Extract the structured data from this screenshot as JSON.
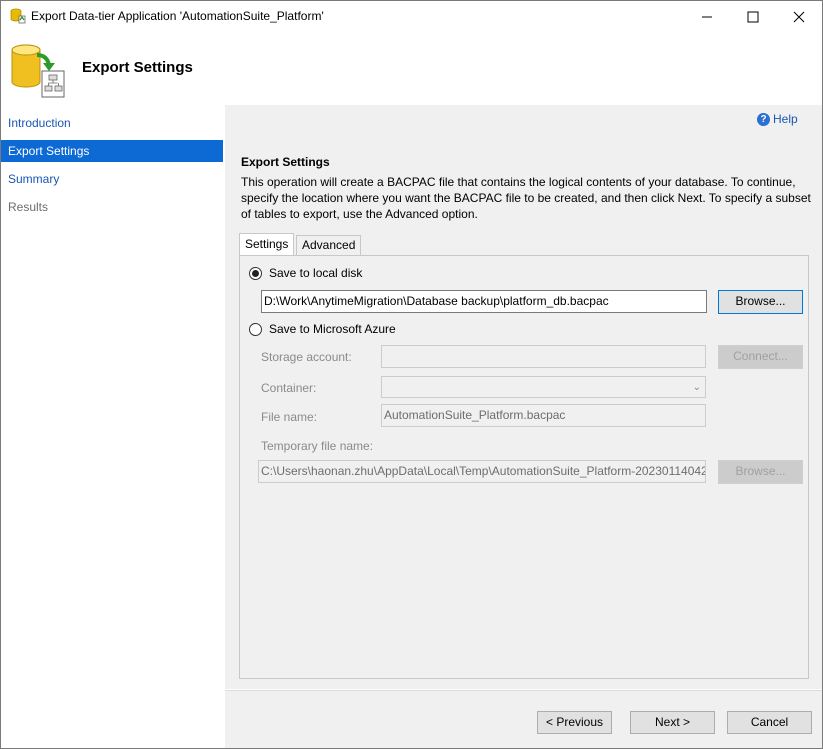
{
  "window": {
    "title": "Export Data-tier Application 'AutomationSuite_Platform'"
  },
  "header": {
    "title": "Export Settings"
  },
  "nav": {
    "items": [
      {
        "label": "Introduction"
      },
      {
        "label": "Export Settings"
      },
      {
        "label": "Summary"
      },
      {
        "label": "Results"
      }
    ]
  },
  "main": {
    "help_label": "Help",
    "section_title": "Export Settings",
    "description": "This operation will create a BACPAC file that contains the logical contents of your database. To continue, specify the location where you want the BACPAC file to be created, and then click Next. To specify a subset of tables to export, use the Advanced option.",
    "tabs": [
      {
        "label": "Settings"
      },
      {
        "label": "Advanced"
      }
    ],
    "local": {
      "radio_label": "Save to local disk",
      "path_value": "D:\\Work\\AnytimeMigration\\Database backup\\platform_db.bacpac",
      "browse_label": "Browse..."
    },
    "azure": {
      "radio_label": "Save to Microsoft Azure",
      "storage_label": "Storage account:",
      "storage_value": "",
      "connect_label": "Connect...",
      "container_label": "Container:",
      "container_value": "",
      "filename_label": "File name:",
      "filename_value": "AutomationSuite_Platform.bacpac",
      "temp_label": "Temporary file name:",
      "temp_value": "C:\\Users\\haonan.zhu\\AppData\\Local\\Temp\\AutomationSuite_Platform-20230114042",
      "browse_label": "Browse..."
    }
  },
  "footer": {
    "previous_label": "< Previous",
    "next_label": "Next >",
    "cancel_label": "Cancel"
  },
  "colors": {
    "accent": "#0d6ad4",
    "link": "#1a56b3",
    "panel_bg": "#f0f0f0"
  },
  "selected_nav_item": "Export Settings",
  "selected_tab": "Settings",
  "selected_destination": "Save to local disk"
}
